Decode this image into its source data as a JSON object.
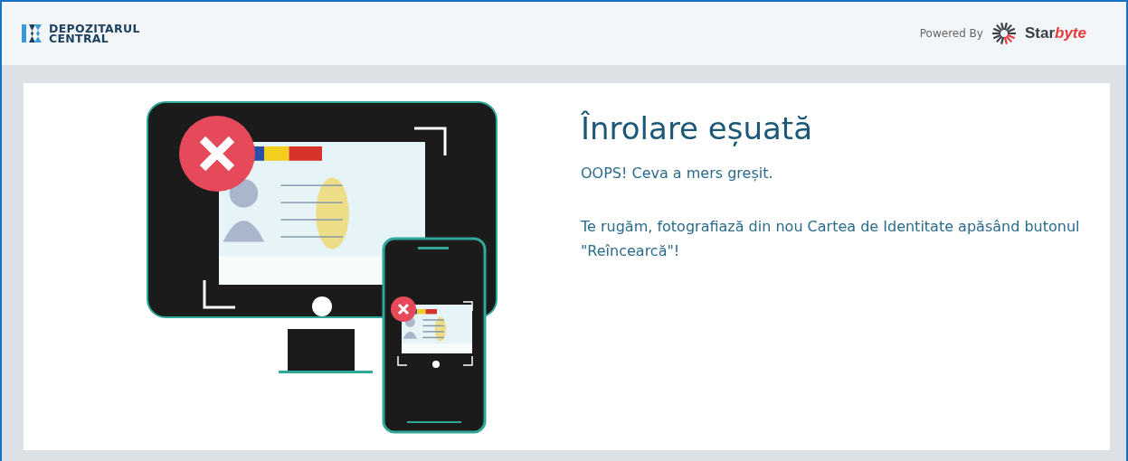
{
  "header": {
    "logo_lines": [
      "DEPOZITARUL",
      "CENTRAL"
    ],
    "powered_by": {
      "label": "Powered By",
      "brand": {
        "text": "Star",
        "accent": "byte"
      }
    }
  },
  "message": {
    "title": "Înrolare eșuată",
    "paragraphs": [
      "OOPS! Ceva a mers greșit.",
      "Te rugăm, fotografiază din nou Cartea de Identitate apăsând butonul \"Reîncearcă\"!"
    ]
  }
}
